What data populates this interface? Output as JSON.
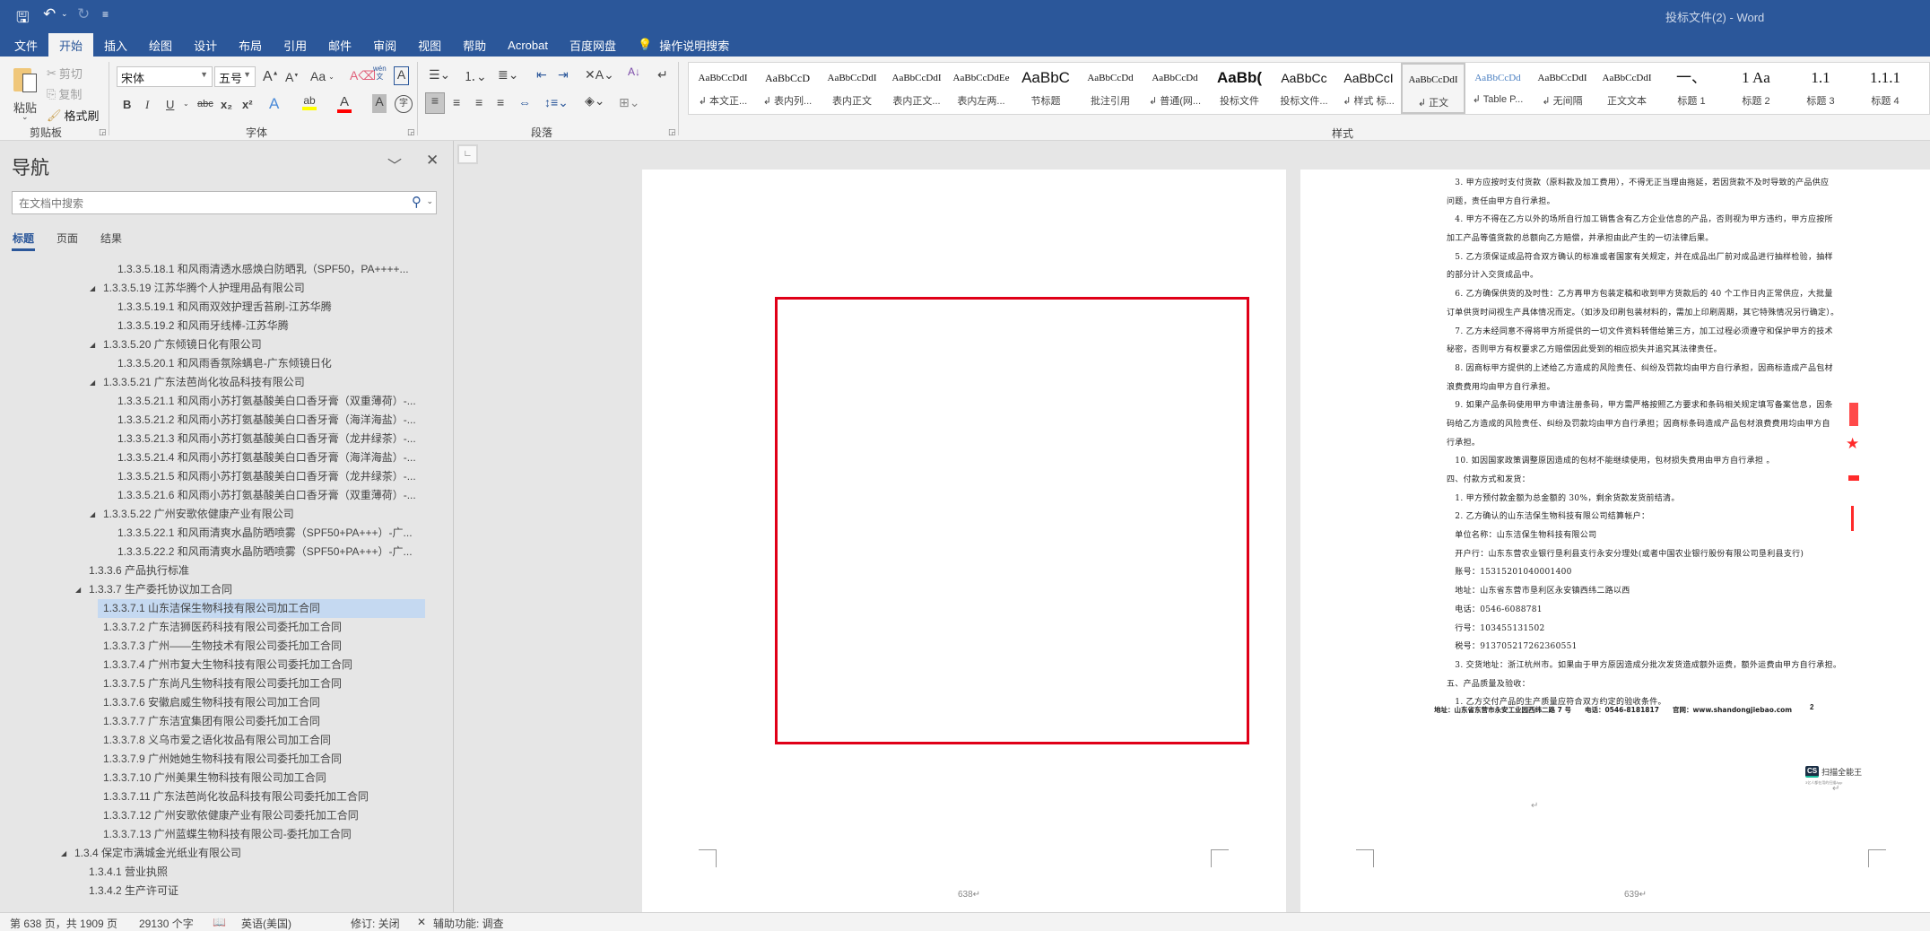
{
  "window": {
    "title": "投标文件(2)  -  Word"
  },
  "qat": {
    "save_icon": "save-icon",
    "undo_icon": "undo-icon",
    "redo_icon": "redo-icon",
    "customize_icon": "customize-qat-icon"
  },
  "tabs": [
    {
      "label": "文件"
    },
    {
      "label": "开始",
      "active": true
    },
    {
      "label": "插入"
    },
    {
      "label": "绘图"
    },
    {
      "label": "设计"
    },
    {
      "label": "布局"
    },
    {
      "label": "引用"
    },
    {
      "label": "邮件"
    },
    {
      "label": "审阅"
    },
    {
      "label": "视图"
    },
    {
      "label": "帮助"
    },
    {
      "label": "Acrobat"
    },
    {
      "label": "百度网盘"
    }
  ],
  "tell_me": "操作说明搜索",
  "ribbon": {
    "clipboard": {
      "label": "剪贴板",
      "paste": "粘贴",
      "cut": "剪切",
      "copy": "复制",
      "format_painter": "格式刷"
    },
    "font": {
      "label": "字体",
      "font_name": "宋体",
      "font_size": "五号",
      "change_case": "Aa",
      "phonetic": "wén",
      "bold": "B",
      "italic": "I",
      "underline": "U",
      "strike": "abc",
      "sub": "x₂",
      "sup": "x²",
      "highlight_color": "#ffff00",
      "font_color": "#ff0000"
    },
    "paragraph": {
      "label": "段落"
    },
    "styles": {
      "label": "样式",
      "items": [
        {
          "preview": "AaBbCcDdI",
          "label": "↲ 本文正..."
        },
        {
          "preview": "AaBbCcD",
          "label": "↲ 表内列..."
        },
        {
          "preview": "AaBbCcDdI",
          "label": "表内正文"
        },
        {
          "preview": "AaBbCcDdI",
          "label": "表内正文..."
        },
        {
          "preview": "AaBbCcDdEe",
          "label": "表内左两..."
        },
        {
          "preview": "AaBbC",
          "label": "节标题"
        },
        {
          "preview": "AaBbCcDd",
          "label": "批注引用"
        },
        {
          "preview": "AaBbCcDd",
          "label": "↲ 普通(网..."
        },
        {
          "preview": "AaBb(",
          "label": "投标文件"
        },
        {
          "preview": "AaBbCc",
          "label": "投标文件..."
        },
        {
          "preview": "AaBbCcI",
          "label": "↲ 样式 标..."
        },
        {
          "preview": "AaBbCcDdI",
          "label": "↲ 正文",
          "selected": true
        },
        {
          "preview": "AaBbCcDd",
          "label": "↲ Table P..."
        },
        {
          "preview": "AaBbCcDdI",
          "label": "↲ 无间隔"
        },
        {
          "preview": "AaBbCcDdI",
          "label": "正文文本"
        },
        {
          "preview": "一、",
          "label": "标题 1"
        },
        {
          "preview": "1   Aa",
          "label": "标题 2"
        },
        {
          "preview": "1.1",
          "label": "标题 3"
        },
        {
          "preview": "1.1.1",
          "label": "标题 4"
        }
      ]
    }
  },
  "nav": {
    "title": "导航",
    "search_placeholder": "在文档中搜索",
    "tabs": [
      "标题",
      "页面",
      "结果"
    ],
    "items": [
      {
        "level": 4,
        "text": "1.3.3.5.18.1 和风雨清透水感焕白防晒乳（SPF50，PA++++..."
      },
      {
        "level": 3,
        "expanded": true,
        "text": "1.3.3.5.19 江苏华腾个人护理用品有限公司"
      },
      {
        "level": 4,
        "text": "1.3.3.5.19.1 和风雨双效护理舌苔刷-江苏华腾"
      },
      {
        "level": 4,
        "text": "1.3.3.5.19.2 和风雨牙线棒-江苏华腾"
      },
      {
        "level": 3,
        "expanded": true,
        "text": "1.3.3.5.20 广东倾镜日化有限公司"
      },
      {
        "level": 4,
        "text": "1.3.3.5.20.1 和风雨香氛除螨皂-广东倾镜日化"
      },
      {
        "level": 3,
        "expanded": true,
        "text": "1.3.3.5.21 广东法芭尚化妆品科技有限公司"
      },
      {
        "level": 4,
        "text": "1.3.3.5.21.1 和风雨小苏打氨基酸美白口香牙膏（双重薄荷）-..."
      },
      {
        "level": 4,
        "text": "1.3.3.5.21.2 和风雨小苏打氨基酸美白口香牙膏（海洋海盐）-..."
      },
      {
        "level": 4,
        "text": "1.3.3.5.21.3 和风雨小苏打氨基酸美白口香牙膏（龙井绿茶）-..."
      },
      {
        "level": 4,
        "text": "1.3.3.5.21.4 和风雨小苏打氨基酸美白口香牙膏（海洋海盐）-..."
      },
      {
        "level": 4,
        "text": "1.3.3.5.21.5 和风雨小苏打氨基酸美白口香牙膏（龙井绿茶）-..."
      },
      {
        "level": 4,
        "text": "1.3.3.5.21.6 和风雨小苏打氨基酸美白口香牙膏（双重薄荷）-..."
      },
      {
        "level": 3,
        "expanded": true,
        "text": "1.3.3.5.22 广州安歌依健康产业有限公司"
      },
      {
        "level": 4,
        "text": "1.3.3.5.22.1 和风雨清爽水晶防晒喷雾（SPF50+PA+++）-广..."
      },
      {
        "level": 4,
        "text": "1.3.3.5.22.2 和风雨清爽水晶防晒喷雾（SPF50+PA+++）-广..."
      },
      {
        "level": 2,
        "text": "1.3.3.6 产品执行标准"
      },
      {
        "level": 2,
        "expanded": true,
        "text": "1.3.3.7 生产委托协议加工合同"
      },
      {
        "level": 3,
        "selected": true,
        "text": "1.3.3.7.1 山东洁保生物科技有限公司加工合同"
      },
      {
        "level": 3,
        "text": "1.3.3.7.2 广东洁狮医药科技有限公司委托加工合同"
      },
      {
        "level": 3,
        "text": "1.3.3.7.3 广州——生物技术有限公司委托加工合同"
      },
      {
        "level": 3,
        "text": "1.3.3.7.4 广州市复大生物科技有限公司委托加工合同"
      },
      {
        "level": 3,
        "text": "1.3.3.7.5 广东尚凡生物科技有限公司委托加工合同"
      },
      {
        "level": 3,
        "text": "1.3.3.7.6 安徽启威生物科技有限公司加工合同"
      },
      {
        "level": 3,
        "text": "1.3.3.7.7 广东洁宜集团有限公司委托加工合同"
      },
      {
        "level": 3,
        "text": "1.3.3.7.8 义乌市爱之语化妆品有限公司加工合同"
      },
      {
        "level": 3,
        "text": "1.3.3.7.9 广州她她生物科技有限公司委托加工合同"
      },
      {
        "level": 3,
        "text": "1.3.3.7.10 广州美果生物科技有限公司加工合同"
      },
      {
        "level": 3,
        "text": "1.3.3.7.11 广东法芭尚化妆品科技有限公司委托加工合同"
      },
      {
        "level": 3,
        "text": "1.3.3.7.12 广州安歌依健康产业有限公司委托加工合同"
      },
      {
        "level": 3,
        "text": "1.3.3.7.13 广州蓝蝶生物科技有限公司-委托加工合同"
      },
      {
        "level": 1,
        "expanded": true,
        "text": "1.3.4 保定市满城金光纸业有限公司"
      },
      {
        "level": 2,
        "text": "1.3.4.1 营业执照"
      },
      {
        "level": 2,
        "text": "1.3.4.2 生产许可证"
      }
    ]
  },
  "document": {
    "pages": [
      {
        "number": "638↵"
      },
      {
        "number": "639↵"
      }
    ],
    "highlight_box_color": "#e00018",
    "scan_lines": [
      "　3. 甲方应按时支付货款（原料款及加工费用），不得无正当理由拖延，若因货款不及时导致的产品供应",
      "问题，责任由甲方自行承担。",
      "　4. 甲方不得在乙方以外的场所自行加工销售含有乙方企业信息的产品，否则视为甲方违约，甲方应按所",
      "加工产品等值货款的总额向乙方赔偿，并承担由此产生的一切法律后果。",
      "　5. 乙方须保证成品符合双方确认的标准或者国家有关规定，并在成品出厂前对成品进行抽样检验，抽样",
      "的部分计入交货成品中。",
      "　6. 乙方确保供货的及时性：乙方再甲方包装定稿和收到甲方货款后的 40 个工作日内正常供应，大批量",
      "订单供货时间视生产具体情况而定。（如涉及印刷包装材料的，需加上印刷周期，其它特殊情况另行确定）。",
      "　7. 乙方未经同意不得将甲方所提供的一切文件资料转借给第三方，加工过程必须遵守和保护甲方的技术",
      "秘密，否则甲方有权要求乙方赔偿因此受到的相应损失并追究其法律责任。",
      "　8. 因商标甲方提供的上述给乙方造成的风险责任、纠纷及罚款均由甲方自行承担，因商标造成产品包材",
      "浪费费用均由甲方自行承担。",
      "　9. 如果产品条码使用甲方申请注册条码，甲方需严格按照乙方要求和条码相关规定填写备案信息，因条",
      "码给乙方造成的风险责任、纠纷及罚款均由甲方自行承担；因商标条码造成产品包材浪费费用均由甲方自",
      "行承担。",
      "　10. 如因国家政策调整原因造成的包材不能继续使用，包材损失费用由甲方自行承担 。",
      "四、付款方式和发货：",
      "　1. 甲方预付款金额为总金额的 30%，剩余货款发货前结清。",
      "　2. 乙方确认的山东洁保生物科技有限公司结算帐户：",
      "　单位名称：山东洁保生物科技有限公司",
      "　开户行：山东东营农业银行垦利县支行永安分理处(或者中国农业银行股份有限公司垦利县支行)",
      "　账号：15315201040001400",
      "　地址：山东省东营市垦利区永安镇西纬二路以西",
      "　电话：0546-6088781",
      "　行号：103455131502",
      "　税号：913705217262360551",
      "　3. 交货地址：浙江杭州市。如果由于甲方原因造成分批次发货造成额外运费，额外运费由甲方自行承担。",
      "五、产品质量及验收：",
      "　1. 乙方交付产品的生产质量应符合双方约定的验收条件。"
    ],
    "scan_footer": "地址：山东省东营市永安工业园西纬二路 7 号　　电话：0546-8181817　　官网：www.shandongjiebao.com",
    "scan_page_no": "2",
    "stamp_color": "#ff2a2a",
    "camscanner": {
      "logo": "CS",
      "name": "扫描全能王",
      "tagline": "3亿人都在用的扫描App"
    }
  },
  "status": {
    "page": "第 638 页，共 1909 页",
    "words": "29130 个字",
    "language": "英语(美国)",
    "track_changes": "修订: 关闭",
    "accessibility": "辅助功能: 调查"
  },
  "colors": {
    "brand": "#2b579a",
    "selection": "#c5d9f1"
  }
}
